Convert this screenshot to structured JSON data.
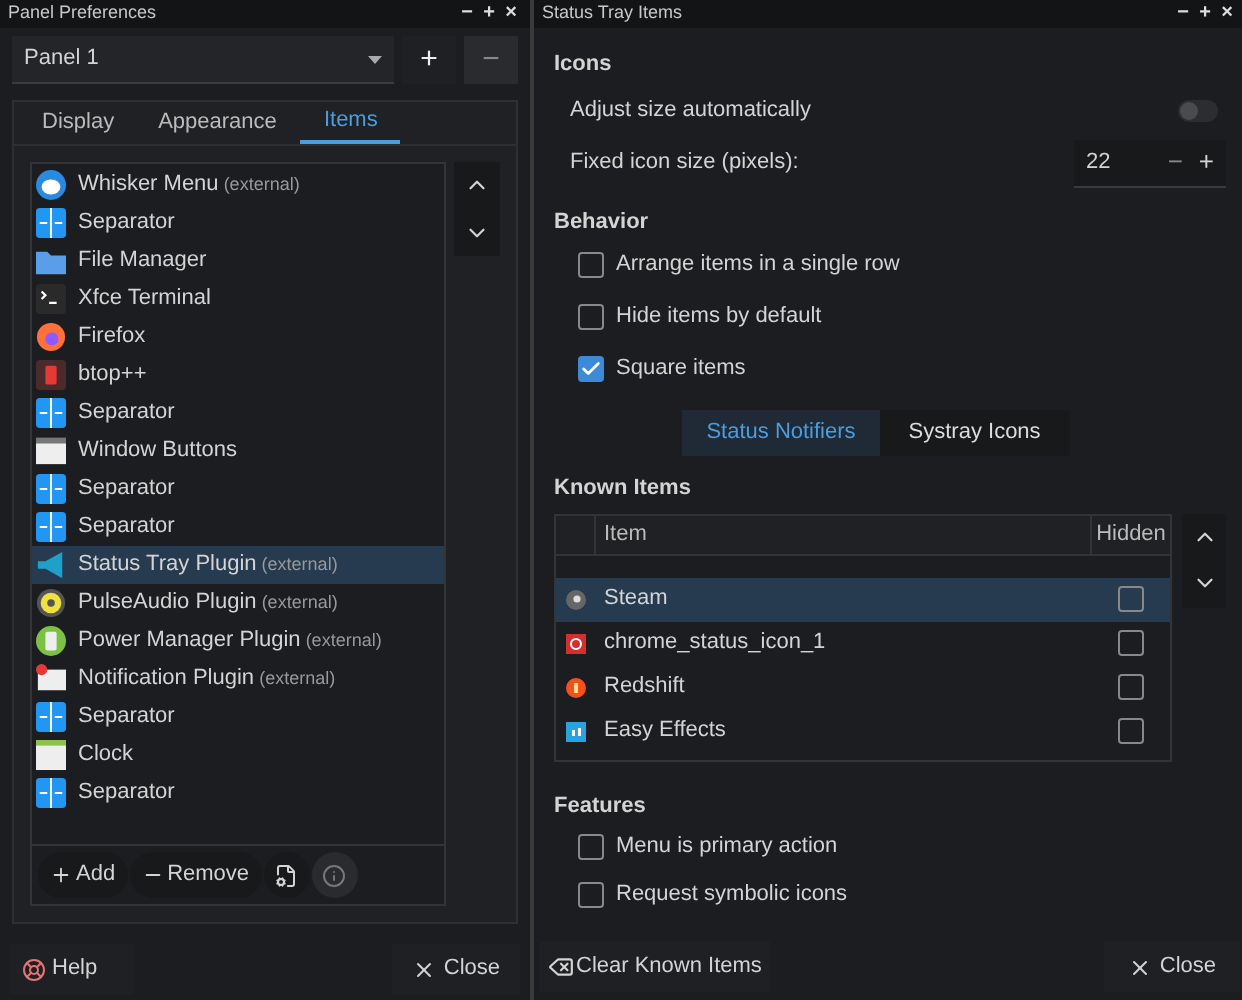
{
  "panel_preferences": {
    "title": "Panel Preferences",
    "title_buttons": [
      "−",
      "+",
      "×"
    ],
    "panel_select": {
      "value": "Panel 1"
    },
    "add_panel": "+",
    "remove_panel": "−",
    "tabs": [
      {
        "label": "Display",
        "selected": false
      },
      {
        "label": "Appearance",
        "selected": false
      },
      {
        "label": "Items",
        "selected": true
      }
    ],
    "items": [
      {
        "name": "Whisker Menu",
        "note": "(external)",
        "selected": false
      },
      {
        "name": "Separator",
        "selected": false
      },
      {
        "name": "File Manager",
        "selected": false
      },
      {
        "name": "Xfce Terminal",
        "selected": false
      },
      {
        "name": "Firefox",
        "selected": false
      },
      {
        "name": "btop++",
        "selected": false
      },
      {
        "name": "Separator",
        "selected": false
      },
      {
        "name": "Window Buttons",
        "selected": false
      },
      {
        "name": "Separator",
        "selected": false
      },
      {
        "name": "Separator",
        "selected": false
      },
      {
        "name": "Status Tray Plugin",
        "note": "(external)",
        "selected": true
      },
      {
        "name": "PulseAudio Plugin",
        "note": "(external)",
        "selected": false
      },
      {
        "name": "Power Manager Plugin",
        "note": "(external)",
        "selected": false
      },
      {
        "name": "Notification Plugin",
        "note": "(external)",
        "selected": false
      },
      {
        "name": "Separator",
        "selected": false
      },
      {
        "name": "Clock",
        "selected": false
      },
      {
        "name": "Separator",
        "selected": false
      }
    ],
    "add_button": "Add",
    "remove_button": "Remove",
    "help_button": "Help",
    "close_button": "Close"
  },
  "status_tray_items": {
    "title": "Status Tray Items",
    "title_buttons": [
      "−",
      "+",
      "×"
    ],
    "icons_heading": "Icons",
    "adjust_size": {
      "label": "Adjust size automatically",
      "on": false
    },
    "fixed_size": {
      "label": "Fixed icon size (pixels):",
      "value": "22",
      "minus": "−",
      "plus": "+"
    },
    "behavior_heading": "Behavior",
    "behavior": [
      {
        "label": "Arrange items in a single row",
        "checked": false
      },
      {
        "label": "Hide items by default",
        "checked": false
      },
      {
        "label": "Square items",
        "checked": true
      }
    ],
    "tabs": [
      {
        "label": "Status Notifiers",
        "selected": true
      },
      {
        "label": "Systray Icons",
        "selected": false
      }
    ],
    "known_heading": "Known Items",
    "table": {
      "columns": [
        "Item",
        "Hidden"
      ],
      "rows": [
        {
          "name": "Steam",
          "hidden": false,
          "selected": true
        },
        {
          "name": "chrome_status_icon_1",
          "hidden": false,
          "selected": false
        },
        {
          "name": "Redshift",
          "hidden": false,
          "selected": false
        },
        {
          "name": "Easy Effects",
          "hidden": false,
          "selected": false
        }
      ]
    },
    "features_heading": "Features",
    "features": [
      {
        "label": "Menu is primary action",
        "checked": false
      },
      {
        "label": "Request symbolic icons",
        "checked": false
      }
    ],
    "clear_button": "Clear Known Items",
    "close_button": "Close"
  }
}
